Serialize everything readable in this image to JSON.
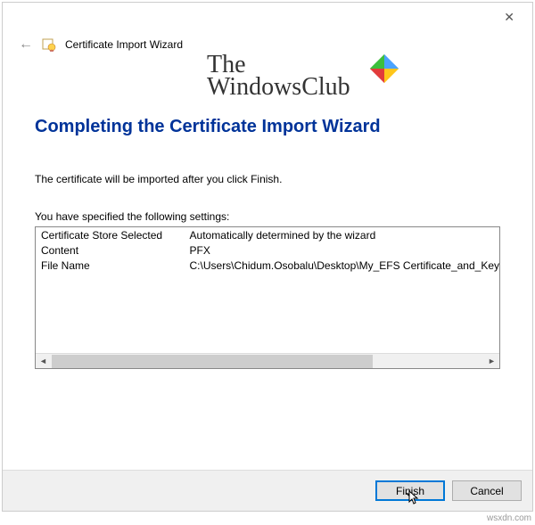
{
  "header": {
    "title": "Certificate Import Wizard"
  },
  "watermark": {
    "line1": "The",
    "line2": "WindowsClub"
  },
  "main": {
    "heading": "Completing the Certificate Import Wizard",
    "intro": "The certificate will be imported after you click Finish.",
    "settings_label": "You have specified the following settings:",
    "rows": [
      {
        "key": "Certificate Store Selected",
        "value": "Automatically determined by the wizard"
      },
      {
        "key": "Content",
        "value": "PFX"
      },
      {
        "key": "File Name",
        "value": "C:\\Users\\Chidum.Osobalu\\Desktop\\My_EFS Certificate_and_Key"
      }
    ]
  },
  "buttons": {
    "finish": "Finish",
    "cancel": "Cancel"
  },
  "credit": "wsxdn.com"
}
